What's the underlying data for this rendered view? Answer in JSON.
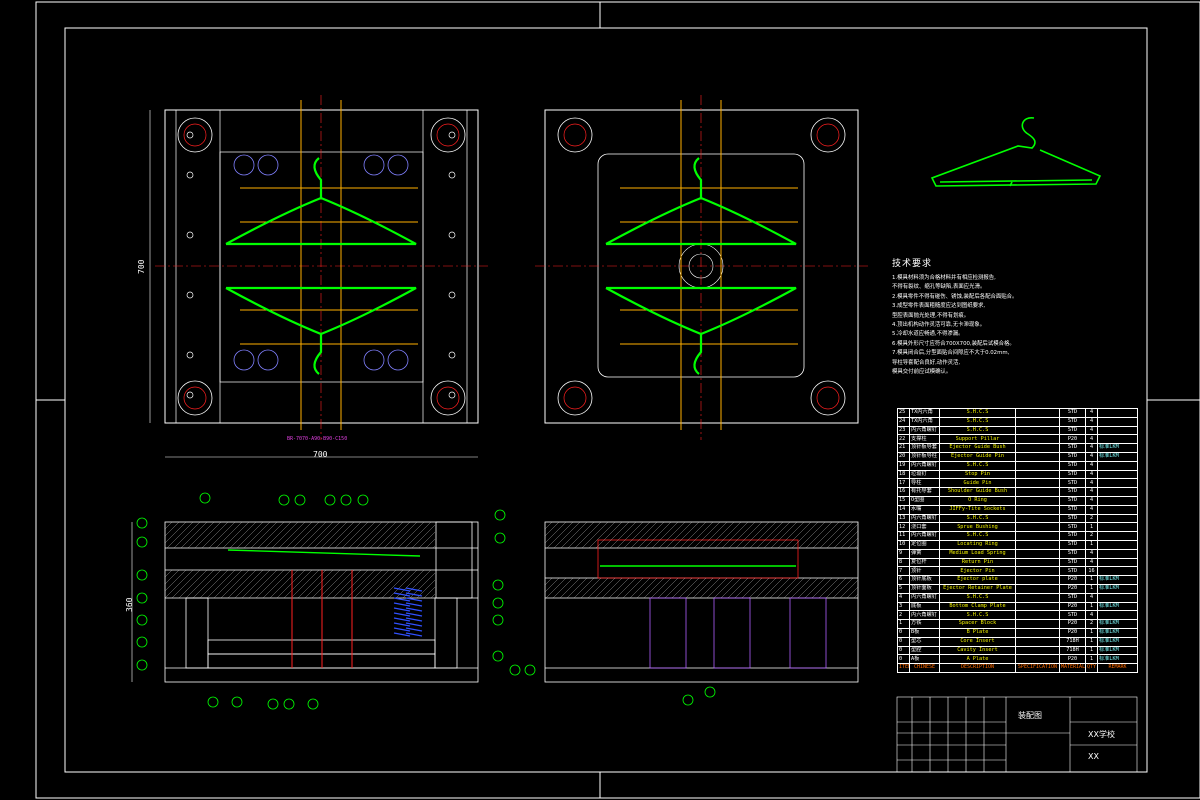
{
  "drawing": {
    "title": "装配图",
    "school": "XX学校",
    "code": "XX",
    "part_number_label": "BR-7070-A90-B90-C150"
  },
  "dimensions": {
    "plan_width": "700",
    "plan_height": "700",
    "section_height": "360"
  },
  "technical_requirements": {
    "title": "技术要求",
    "notes": [
      "1.模具材料须为合格材料并有相应检测报告,",
      "  不得有裂纹、缩孔等缺陷,表面应光滑。",
      "2.模具零件不得有碰伤、锈蚀,装配后各配合面贴合。",
      "3.成型零件表面粗糙度应达到图纸要求,",
      "  型腔表面抛光处理,不得有划痕。",
      "4.顶出机构动作灵活可靠,无卡滞现象。",
      "5.冷却水道应畅通,不得渗漏。",
      "6.模具外形尺寸应符合700X700,装配后试模合格。",
      "7.模具闭合后,分型面贴合间隙应不大于0.02mm,",
      "  导柱导套配合良好,动作灵活,",
      "  模具交付前应试模确认。"
    ]
  },
  "bom": {
    "headers": [
      "ITEM",
      "CHINESE",
      "DESCRIPTION",
      "SPECIFICATION",
      "MATERIAL",
      "QTY.",
      "REMARK"
    ],
    "rows": [
      {
        "item": "25",
        "cn": "TX内六角",
        "desc": "S.H.C.S",
        "spec": "",
        "mat": "STD",
        "qty": "4",
        "rem": ""
      },
      {
        "item": "24",
        "cn": "TX内六角",
        "desc": "S.H.C.S",
        "spec": "",
        "mat": "STD",
        "qty": "4",
        "rem": ""
      },
      {
        "item": "23",
        "cn": "内六角螺钉",
        "desc": "S.H.C.S",
        "spec": "",
        "mat": "STD",
        "qty": "4",
        "rem": ""
      },
      {
        "item": "22",
        "cn": "支撑柱",
        "desc": "Support Pillar",
        "spec": "",
        "mat": "P20",
        "qty": "4",
        "rem": ""
      },
      {
        "item": "21",
        "cn": "顶针板导套",
        "desc": "Ejector Guide Bush",
        "spec": "",
        "mat": "STD",
        "qty": "4",
        "rem": "标准LKM"
      },
      {
        "item": "20",
        "cn": "顶针板导柱",
        "desc": "Ejector Guide Pin",
        "spec": "",
        "mat": "STD",
        "qty": "4",
        "rem": "标准LKM"
      },
      {
        "item": "19",
        "cn": "内六角螺钉",
        "desc": "S.H.C.S",
        "spec": "",
        "mat": "STD",
        "qty": "4",
        "rem": ""
      },
      {
        "item": "18",
        "cn": "垃圾钉",
        "desc": "Stop Pin",
        "spec": "",
        "mat": "STD",
        "qty": "4",
        "rem": ""
      },
      {
        "item": "17",
        "cn": "导柱",
        "desc": "Guide Pin",
        "spec": "",
        "mat": "STD",
        "qty": "4",
        "rem": ""
      },
      {
        "item": "16",
        "cn": "有托导套",
        "desc": "Shoulder Guide Bush",
        "spec": "",
        "mat": "STD",
        "qty": "4",
        "rem": ""
      },
      {
        "item": "15",
        "cn": "O型圈",
        "desc": "O Ring",
        "spec": "",
        "mat": "STD",
        "qty": "4",
        "rem": ""
      },
      {
        "item": "14",
        "cn": "水嘴",
        "desc": "JIFFy-Tite Sockets",
        "spec": "",
        "mat": "STD",
        "qty": "4",
        "rem": ""
      },
      {
        "item": "13",
        "cn": "内六角螺钉",
        "desc": "S.H.C.S",
        "spec": "",
        "mat": "STD",
        "qty": "2",
        "rem": ""
      },
      {
        "item": "12",
        "cn": "浇口套",
        "desc": "Sprue Bushing",
        "spec": "",
        "mat": "STD",
        "qty": "1",
        "rem": ""
      },
      {
        "item": "11",
        "cn": "内六角螺钉",
        "desc": "S.H.C.S",
        "spec": "",
        "mat": "STD",
        "qty": "2",
        "rem": ""
      },
      {
        "item": "10",
        "cn": "定位圈",
        "desc": "Locating Ring",
        "spec": "",
        "mat": "STD",
        "qty": "1",
        "rem": ""
      },
      {
        "item": "9",
        "cn": "弹簧",
        "desc": "Medium Load Spring",
        "spec": "",
        "mat": "STD",
        "qty": "4",
        "rem": ""
      },
      {
        "item": "8",
        "cn": "复位杆",
        "desc": "Return Pin",
        "spec": "",
        "mat": "STD",
        "qty": "4",
        "rem": ""
      },
      {
        "item": "7",
        "cn": "顶针",
        "desc": "Ejector Pin",
        "spec": "",
        "mat": "STD",
        "qty": "16",
        "rem": ""
      },
      {
        "item": "6",
        "cn": "顶针底板",
        "desc": "Ejector plate",
        "spec": "",
        "mat": "P20",
        "qty": "1",
        "rem": "标准LKM"
      },
      {
        "item": "5",
        "cn": "顶针面板",
        "desc": "Ejector Retainer Plate",
        "spec": "",
        "mat": "P20",
        "qty": "1",
        "rem": "标准LKM"
      },
      {
        "item": "4",
        "cn": "内六角螺钉",
        "desc": "S.H.C.S",
        "spec": "",
        "mat": "STD",
        "qty": "4",
        "rem": ""
      },
      {
        "item": "3",
        "cn": "底板",
        "desc": "Bottom Clamp Plate",
        "spec": "",
        "mat": "P20",
        "qty": "1",
        "rem": "标准LKM"
      },
      {
        "item": "2",
        "cn": "内六角螺钉",
        "desc": "S.H.C.S",
        "spec": "",
        "mat": "STD",
        "qty": "4",
        "rem": ""
      },
      {
        "item": "1",
        "cn": "方铁",
        "desc": "Spacer Block",
        "spec": "",
        "mat": "P20",
        "qty": "2",
        "rem": "标准LKM"
      },
      {
        "item": "0",
        "cn": "B板",
        "desc": "B Plate",
        "spec": "",
        "mat": "P20",
        "qty": "1",
        "rem": "标准LKM"
      },
      {
        "item": "0",
        "cn": "型芯",
        "desc": "Core Insert",
        "spec": "",
        "mat": "718H",
        "qty": "1",
        "rem": "标准LKM"
      },
      {
        "item": "0",
        "cn": "型腔",
        "desc": "Cavity Insert",
        "spec": "",
        "mat": "718H",
        "qty": "1",
        "rem": "标准LKM"
      },
      {
        "item": "0",
        "cn": "A板",
        "desc": "A Plate",
        "spec": "",
        "mat": "P20",
        "qty": "1",
        "rem": "标准LKM"
      }
    ]
  },
  "colors": {
    "background": "#000000",
    "line": "#ffffff",
    "part": "#00ff00",
    "hidden": "#ff2020",
    "guide": "#ffb000",
    "circle": "#8080ff",
    "magenta": "#e040e0"
  }
}
